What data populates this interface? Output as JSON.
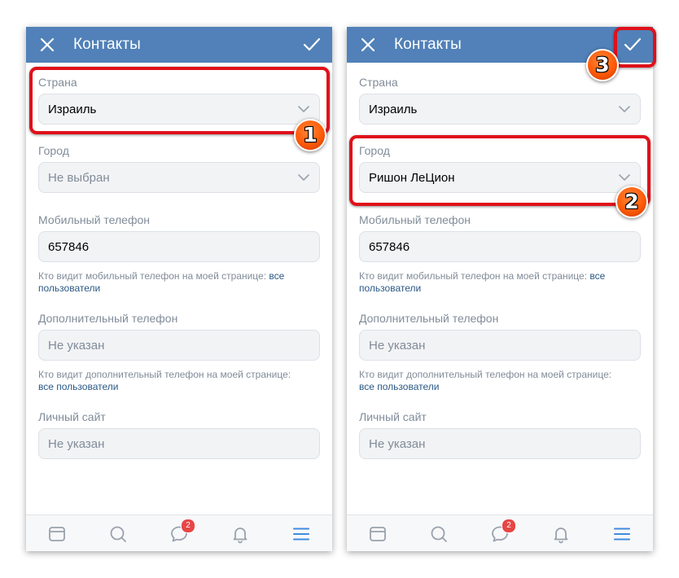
{
  "screens": [
    {
      "header": {
        "title": "Контакты"
      },
      "country": {
        "label": "Страна",
        "value": "Израиль"
      },
      "city": {
        "label": "Город",
        "value": "Не выбран"
      },
      "mobile_phone": {
        "label": "Мобильный телефон",
        "value": "657846"
      },
      "mobile_hint": {
        "text": "Кто видит мобильный телефон на моей странице: ",
        "link": "все пользователи"
      },
      "extra_phone": {
        "label": "Дополнительный телефон",
        "placeholder": "Не указан"
      },
      "extra_hint": {
        "text": "Кто видит дополнительный телефон на моей странице: ",
        "link": "все пользователи"
      },
      "website": {
        "label": "Личный сайт",
        "placeholder": "Не указан"
      },
      "tabbar": {
        "messages_badge": "2"
      }
    },
    {
      "header": {
        "title": "Контакты"
      },
      "country": {
        "label": "Страна",
        "value": "Израиль"
      },
      "city": {
        "label": "Город",
        "value": "Ришон ЛеЦион"
      },
      "mobile_phone": {
        "label": "Мобильный телефон",
        "value": "657846"
      },
      "mobile_hint": {
        "text": "Кто видит мобильный телефон на моей странице: ",
        "link": "все пользователи"
      },
      "extra_phone": {
        "label": "Дополнительный телефон",
        "placeholder": "Не указан"
      },
      "extra_hint": {
        "text": "Кто видит дополнительный телефон на моей странице: ",
        "link": "все пользователи"
      },
      "website": {
        "label": "Личный сайт",
        "placeholder": "Не указан"
      },
      "tabbar": {
        "messages_badge": "2"
      }
    }
  ],
  "annotations": {
    "step1": "1",
    "step2": "2",
    "step3": "3"
  },
  "colors": {
    "header": "#5181b8",
    "field_bg": "#f2f3f5",
    "label": "#818c99",
    "link": "#2a5885",
    "highlight": "#e0101a",
    "badge": "#e64646",
    "step_marker": "#ff5a08"
  },
  "icons": {
    "close": "close-icon",
    "confirm": "check-icon",
    "dropdown": "chevron-down-icon",
    "tabs": [
      "news-icon",
      "search-icon",
      "messages-icon",
      "notifications-icon",
      "menu-icon"
    ]
  }
}
